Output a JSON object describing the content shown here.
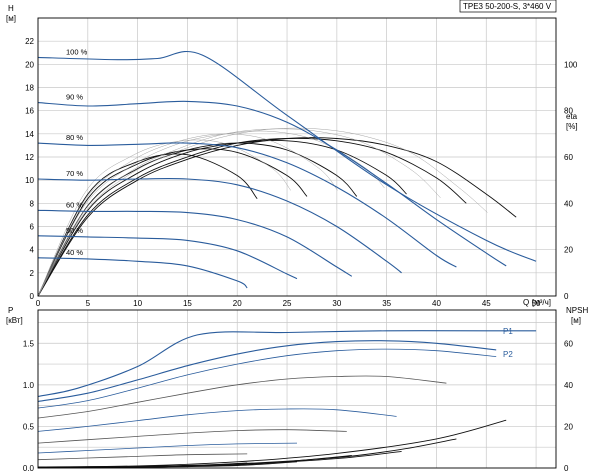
{
  "chart_data": [
    {
      "type": "line",
      "panel": "head",
      "title": "TPE3 50-200-S, 3*460 V",
      "ylabel": "H",
      "ylabel_unit": "[м]",
      "right_label": "eta",
      "right_unit": "[%]",
      "xlabel": "Q",
      "xlabel_unit": "[м³/ч]",
      "xlim": [
        0,
        52
      ],
      "ylim": [
        0,
        24
      ],
      "right_ylim": [
        0,
        120
      ],
      "x_ticks": [
        0,
        5,
        10,
        15,
        20,
        25,
        30,
        35,
        40,
        45,
        50
      ],
      "y_ticks": [
        0,
        2,
        4,
        6,
        8,
        10,
        12,
        14,
        16,
        18,
        20,
        22
      ],
      "right_ticks": [
        0,
        20,
        40,
        60,
        80,
        100
      ],
      "grid": true,
      "head_curves": [
        {
          "name": "100 %",
          "x": [
            0,
            8,
            12,
            16.5,
            25,
            35,
            45,
            50
          ],
          "y": [
            20.6,
            20.4,
            20.5,
            20.8,
            15.6,
            9.6,
            4.8,
            3.0
          ]
        },
        {
          "name": "90 %",
          "x": [
            0,
            5,
            10,
            15,
            20,
            25,
            30,
            35,
            40,
            45,
            47
          ],
          "y": [
            16.7,
            16.4,
            16.6,
            16.8,
            16.4,
            15.0,
            12.6,
            9.7,
            6.6,
            3.7,
            2.6
          ]
        },
        {
          "name": "80 %",
          "x": [
            0,
            5,
            10,
            15,
            20,
            25,
            30,
            35,
            40,
            42
          ],
          "y": [
            13.2,
            13.0,
            13.1,
            13.2,
            12.8,
            11.5,
            9.4,
            6.7,
            3.5,
            2.5
          ]
        },
        {
          "name": "70 %",
          "x": [
            0,
            5,
            10,
            15,
            20,
            25,
            30,
            35,
            36.5
          ],
          "y": [
            10.1,
            10.0,
            10.1,
            10.1,
            9.6,
            8.2,
            6.0,
            3.0,
            2.0
          ]
        },
        {
          "name": "60 %",
          "x": [
            0,
            5,
            10,
            15,
            20,
            25,
            30,
            31.5
          ],
          "y": [
            7.4,
            7.3,
            7.3,
            7.2,
            6.6,
            5.1,
            2.5,
            1.7
          ]
        },
        {
          "name": "50 %",
          "x": [
            0,
            5,
            10,
            15,
            20,
            25,
            26
          ],
          "y": [
            5.2,
            5.1,
            5.0,
            4.8,
            3.9,
            1.9,
            1.5
          ]
        },
        {
          "name": "40 %",
          "x": [
            0,
            5,
            10,
            15,
            20,
            21
          ],
          "y": [
            3.3,
            3.2,
            3.0,
            2.6,
            1.3,
            0.7
          ]
        }
      ],
      "eta_curves": [
        {
          "x": [
            0,
            5,
            10,
            15,
            20,
            25,
            30,
            35,
            40,
            45,
            48
          ],
          "y": [
            0,
            34,
            50,
            59,
            65,
            68,
            68,
            65,
            58,
            44,
            34
          ]
        },
        {
          "x": [
            0,
            5,
            10,
            15,
            20,
            25,
            30,
            35,
            40,
            43
          ],
          "y": [
            0,
            35,
            51,
            60,
            66,
            68,
            67,
            62,
            51,
            40
          ]
        },
        {
          "x": [
            0,
            5,
            10,
            15,
            20,
            25,
            30,
            35,
            37
          ],
          "y": [
            0,
            37,
            53,
            62,
            66,
            67,
            63,
            52,
            44
          ]
        },
        {
          "x": [
            0,
            5,
            10,
            15,
            20,
            25,
            30,
            32
          ],
          "y": [
            0,
            39,
            55,
            63,
            66,
            63,
            52,
            43
          ]
        },
        {
          "x": [
            0,
            5,
            10,
            15,
            20,
            25,
            27
          ],
          "y": [
            0,
            42,
            57,
            63,
            62,
            52,
            43
          ]
        },
        {
          "x": [
            0,
            5,
            10,
            15,
            20,
            22
          ],
          "y": [
            0,
            44,
            58,
            61,
            52,
            42
          ]
        }
      ]
    },
    {
      "type": "line",
      "panel": "power",
      "ylabel": "P",
      "ylabel_unit": "[кВт]",
      "right_label": "NPSH",
      "right_unit": "[м]",
      "xlim": [
        0,
        52
      ],
      "ylim": [
        0,
        1.9
      ],
      "right_ylim": [
        0,
        76
      ],
      "y_ticks": [
        0,
        0.5,
        1.0,
        1.5
      ],
      "right_ticks": [
        0,
        20,
        40,
        60
      ],
      "grid": true,
      "series_labels": [
        "P1",
        "P2"
      ],
      "power_curves": [
        {
          "name": "P1",
          "x": [
            0,
            4,
            10,
            16,
            25,
            35,
            45,
            50
          ],
          "y": [
            0.86,
            0.96,
            1.22,
            1.6,
            1.63,
            1.65,
            1.65,
            1.65
          ]
        },
        {
          "name": "P2",
          "x": [
            0,
            5,
            10,
            15,
            20,
            25,
            30,
            35,
            40,
            46
          ],
          "y": [
            0.8,
            0.9,
            1.06,
            1.23,
            1.37,
            1.47,
            1.52,
            1.53,
            1.5,
            1.42
          ]
        },
        {
          "x": [
            0,
            5,
            10,
            15,
            20,
            25,
            30,
            35,
            40,
            46
          ],
          "y": [
            0.72,
            0.81,
            0.96,
            1.12,
            1.25,
            1.35,
            1.41,
            1.43,
            1.41,
            1.34
          ]
        },
        {
          "x": [
            0,
            5,
            10,
            15,
            20,
            25,
            30,
            35,
            41
          ],
          "y": [
            0.6,
            0.68,
            0.79,
            0.9,
            1.0,
            1.07,
            1.1,
            1.1,
            1.02
          ]
        },
        {
          "x": [
            0,
            5,
            10,
            15,
            20,
            25,
            30,
            36
          ],
          "y": [
            0.44,
            0.5,
            0.57,
            0.64,
            0.69,
            0.71,
            0.7,
            0.62
          ]
        },
        {
          "x": [
            0,
            5,
            10,
            15,
            20,
            25,
            31
          ],
          "y": [
            0.3,
            0.34,
            0.38,
            0.42,
            0.45,
            0.46,
            0.44
          ]
        },
        {
          "x": [
            0,
            5,
            10,
            15,
            20,
            26
          ],
          "y": [
            0.18,
            0.21,
            0.24,
            0.27,
            0.29,
            0.3
          ]
        },
        {
          "x": [
            0,
            5,
            10,
            15,
            21
          ],
          "y": [
            0.1,
            0.12,
            0.14,
            0.16,
            0.17
          ]
        }
      ],
      "npsh_curves": [
        {
          "x": [
            0,
            10,
            20,
            30,
            40,
            47
          ],
          "y": [
            0.5,
            1,
            3,
            7,
            14,
            23
          ]
        },
        {
          "x": [
            0,
            10,
            20,
            30,
            36.5,
            42
          ],
          "y": [
            0.4,
            0.8,
            2,
            5,
            9,
            14
          ]
        },
        {
          "x": [
            0,
            10,
            20,
            30,
            36.5
          ],
          "y": [
            0.3,
            0.6,
            1.8,
            4.5,
            8
          ]
        },
        {
          "x": [
            0,
            10,
            20,
            26,
            31.5
          ],
          "y": [
            0.2,
            0.5,
            1.5,
            3.5,
            6
          ]
        },
        {
          "x": [
            0,
            10,
            20,
            26
          ],
          "y": [
            0.2,
            0.4,
            1.2,
            3
          ]
        },
        {
          "x": [
            0,
            10,
            15,
            21
          ],
          "y": [
            0.1,
            0.3,
            1.0,
            2.4
          ]
        }
      ]
    }
  ]
}
